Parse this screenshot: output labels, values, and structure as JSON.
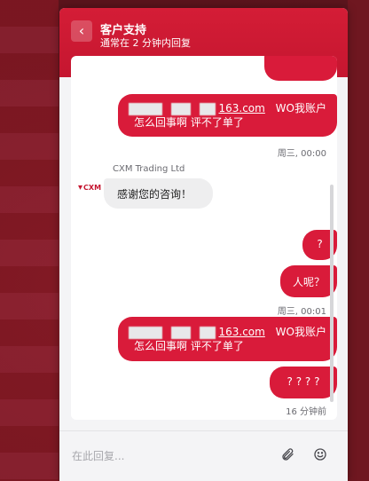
{
  "header": {
    "title": "客户支持",
    "subtitle": "通常在 2 分钟内回复",
    "back_glyph": "‹"
  },
  "messages": [
    {
      "id": "out1_line1_suffix",
      "text": "163.com"
    },
    {
      "id": "out1_line1_tail",
      "text": "WO我账户"
    },
    {
      "id": "out1_line2",
      "text": "怎么回事啊  评不了单了"
    },
    {
      "id": "ts1",
      "text": "周三, 00:00"
    },
    {
      "id": "sender",
      "text": "CXM Trading Ltd"
    },
    {
      "id": "avatar_text",
      "text": "CXM"
    },
    {
      "id": "in1",
      "text": "感谢您的咨询！"
    },
    {
      "id": "out2",
      "text": "?"
    },
    {
      "id": "out3",
      "text": "人呢？"
    },
    {
      "id": "ts2",
      "text": "周三, 00:01"
    },
    {
      "id": "out4_line1_suffix",
      "text": "163.com"
    },
    {
      "id": "out4_line1_tail",
      "text": "WO我账户"
    },
    {
      "id": "out4_line2",
      "text": "怎么回事啊  评不了单了"
    },
    {
      "id": "out5",
      "text": "? ? ? ?"
    },
    {
      "id": "ts3",
      "text": "16 分钟前"
    }
  ],
  "composer": {
    "placeholder": "在此回复...",
    "attach_icon": "paperclip-icon",
    "emoji_icon": "smiley-icon"
  },
  "colors": {
    "brand_red": "#d91b3a",
    "header_red": "#c51630"
  }
}
